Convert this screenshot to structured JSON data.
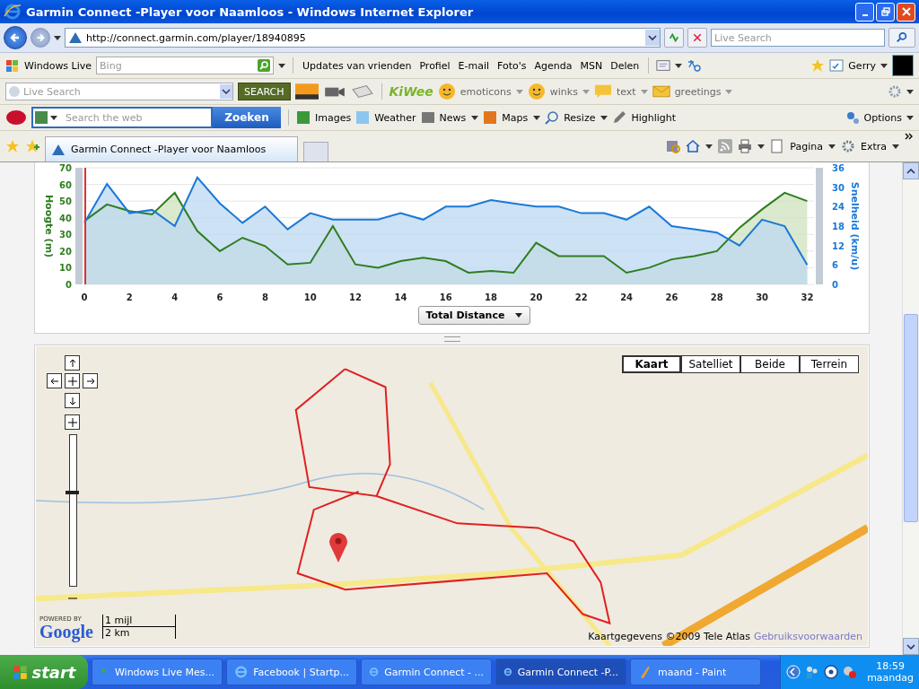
{
  "window": {
    "title": "Garmin Connect -Player voor Naamloos - Windows Internet Explorer"
  },
  "address_bar": {
    "url": "http://connect.garmin.com/player/18940895",
    "search_placeholder": "Live Search"
  },
  "windows_live_toolbar": {
    "brand": "Windows Live",
    "search_placeholder": "Bing",
    "links": [
      "Updates van vrienden",
      "Profiel",
      "E-mail",
      "Foto's",
      "Agenda",
      "MSN",
      "Delen"
    ],
    "user": "Gerry"
  },
  "kiwee_toolbar": {
    "search_placeholder": "Live Search",
    "search_button": "SEARCH",
    "logo": "KiWee",
    "items": [
      "emoticons",
      "winks",
      "text",
      "greetings"
    ]
  },
  "ask_toolbar": {
    "search_placeholder": "Search the web",
    "search_button": "Zoeken",
    "items": [
      {
        "label": "Images",
        "kind": "images",
        "menu": false
      },
      {
        "label": "Weather",
        "kind": "weather",
        "menu": false
      },
      {
        "label": "News",
        "kind": "news",
        "menu": true
      },
      {
        "label": "Maps",
        "kind": "maps",
        "menu": true
      },
      {
        "label": "Resize",
        "kind": "resize",
        "menu": true
      },
      {
        "label": "Highlight",
        "kind": "highlight",
        "menu": false
      }
    ],
    "options": "Options"
  },
  "tabs": [
    {
      "label": "Garmin Connect -Player voor Naamloos",
      "selected": true
    }
  ],
  "command_bar": [
    "Pagina",
    "Extra"
  ],
  "chart": {
    "chart_data": {
      "type": "area",
      "xlabel": "Total Distance",
      "grid": true,
      "x": [
        0,
        1,
        2,
        3,
        4,
        5,
        6,
        7,
        8,
        9,
        10,
        11,
        12,
        13,
        14,
        15,
        16,
        17,
        18,
        19,
        20,
        21,
        22,
        23,
        24,
        25,
        26,
        27,
        28,
        29,
        30,
        31,
        32
      ],
      "series": [
        {
          "name": "Hoogte (m)",
          "color": "#2e7d1e",
          "values": [
            38,
            48,
            44,
            42,
            55,
            32,
            20,
            28,
            23,
            12,
            13,
            35,
            12,
            10,
            14,
            16,
            14,
            7,
            8,
            7,
            25,
            17,
            17,
            17,
            7,
            10,
            15,
            17,
            20,
            34,
            45,
            55,
            50
          ]
        },
        {
          "name": "Snelheid (km/u)",
          "color": "#1a78d6",
          "axis": "y2",
          "values": [
            19,
            31,
            22,
            23,
            18,
            33,
            25,
            19,
            24,
            17,
            22,
            20,
            20,
            20,
            22,
            20,
            24,
            24,
            26,
            25,
            24,
            24,
            22,
            22,
            20,
            24,
            18,
            17,
            16,
            12,
            20,
            18,
            6
          ]
        }
      ],
      "xlim": [
        0,
        32.3
      ],
      "ylim": [
        0,
        70
      ],
      "y2lim": [
        0,
        36
      ],
      "xticks": [
        0,
        2,
        4,
        6,
        8,
        10,
        12,
        14,
        16,
        18,
        20,
        22,
        24,
        26,
        28,
        30,
        32
      ],
      "yticks": [
        0,
        10,
        20,
        30,
        40,
        50,
        60,
        70
      ],
      "y2ticks": [
        0,
        6,
        12,
        18,
        24,
        30,
        36
      ]
    }
  },
  "map": {
    "zoom_slider": {
      "level": 0.62
    },
    "types": [
      {
        "label": "Kaart",
        "selected": true
      },
      {
        "label": "Satelliet",
        "selected": false
      },
      {
        "label": "Beide",
        "selected": false
      },
      {
        "label": "Terrein",
        "selected": false
      }
    ],
    "powered_by": "POWERED BY",
    "logo": "Google",
    "scale": [
      "1 mijl",
      "2 km"
    ],
    "copyright": "Kaartgegevens ©2009 Tele Atlas",
    "terms": "Gebruiksvoorwaarden"
  },
  "taskbar": {
    "start": "start",
    "items": [
      {
        "label": "Windows Live Mes...",
        "kind": "messenger",
        "selected": false
      },
      {
        "label": "Facebook | Startp...",
        "kind": "ie",
        "selected": false
      },
      {
        "label": "Garmin Connect - ...",
        "kind": "ie",
        "selected": false
      },
      {
        "label": "Garmin Connect -P...",
        "kind": "ie",
        "selected": true
      },
      {
        "label": "maand - Paint",
        "kind": "paint",
        "selected": false
      }
    ],
    "time": "18:59",
    "day": "maandag"
  }
}
